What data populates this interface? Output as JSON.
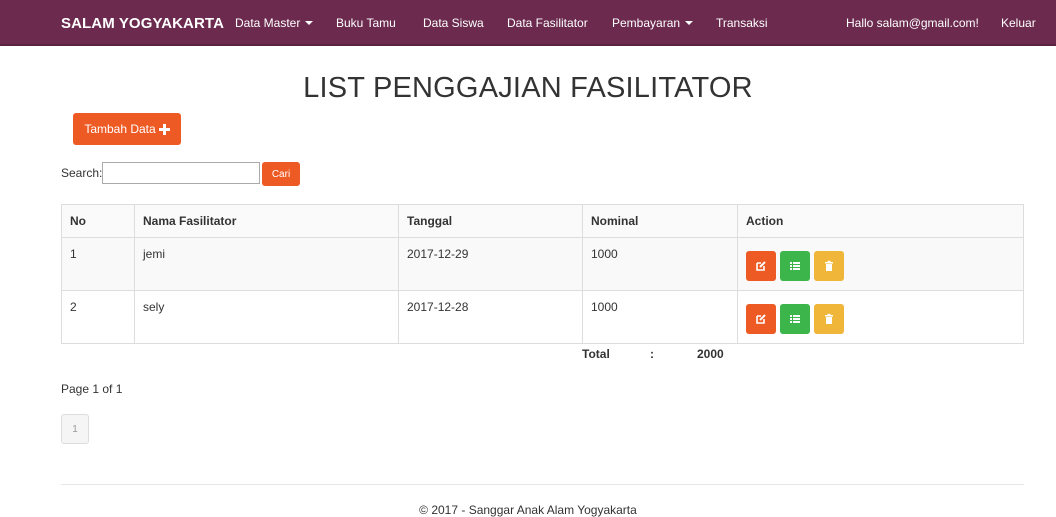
{
  "navbar": {
    "brand": "SALAM YOGYAKARTA",
    "items": [
      {
        "label": "Data Master",
        "dropdown": true
      },
      {
        "label": "Buku Tamu",
        "dropdown": false
      },
      {
        "label": "Data Siswa",
        "dropdown": false
      },
      {
        "label": "Data Fasilitator",
        "dropdown": false
      },
      {
        "label": "Pembayaran",
        "dropdown": true
      },
      {
        "label": "Transaksi",
        "dropdown": false
      }
    ],
    "greeting": "Hallo salam@gmail.com!",
    "logout": "Keluar"
  },
  "page": {
    "title": "LIST PENGGAJIAN FASILITATOR",
    "add_button": "Tambah Data"
  },
  "search": {
    "label": "Search:",
    "value": "",
    "button": "Cari"
  },
  "table": {
    "headers": [
      "No",
      "Nama Fasilitator",
      "Tanggal",
      "Nominal",
      "Action"
    ],
    "rows": [
      {
        "no": "1",
        "nama": "jemi",
        "tanggal": "2017-12-29",
        "nominal": "1000"
      },
      {
        "no": "2",
        "nama": "sely",
        "tanggal": "2017-12-28",
        "nominal": "1000"
      }
    ]
  },
  "total": {
    "label": "Total",
    "separator": ":",
    "value": "2000"
  },
  "pagination": {
    "info": "Page 1 of 1",
    "pages": [
      "1"
    ]
  },
  "footer": "© 2017 - Sanggar Anak Alam Yogyakarta",
  "colors": {
    "navbar": "#6b2a4e",
    "primary": "#ee5a24",
    "success": "#3cb54a",
    "warning": "#f0b63a"
  },
  "icons": {
    "add": "plus-icon",
    "edit": "edit-icon",
    "detail": "list-icon",
    "delete": "trash-icon"
  }
}
